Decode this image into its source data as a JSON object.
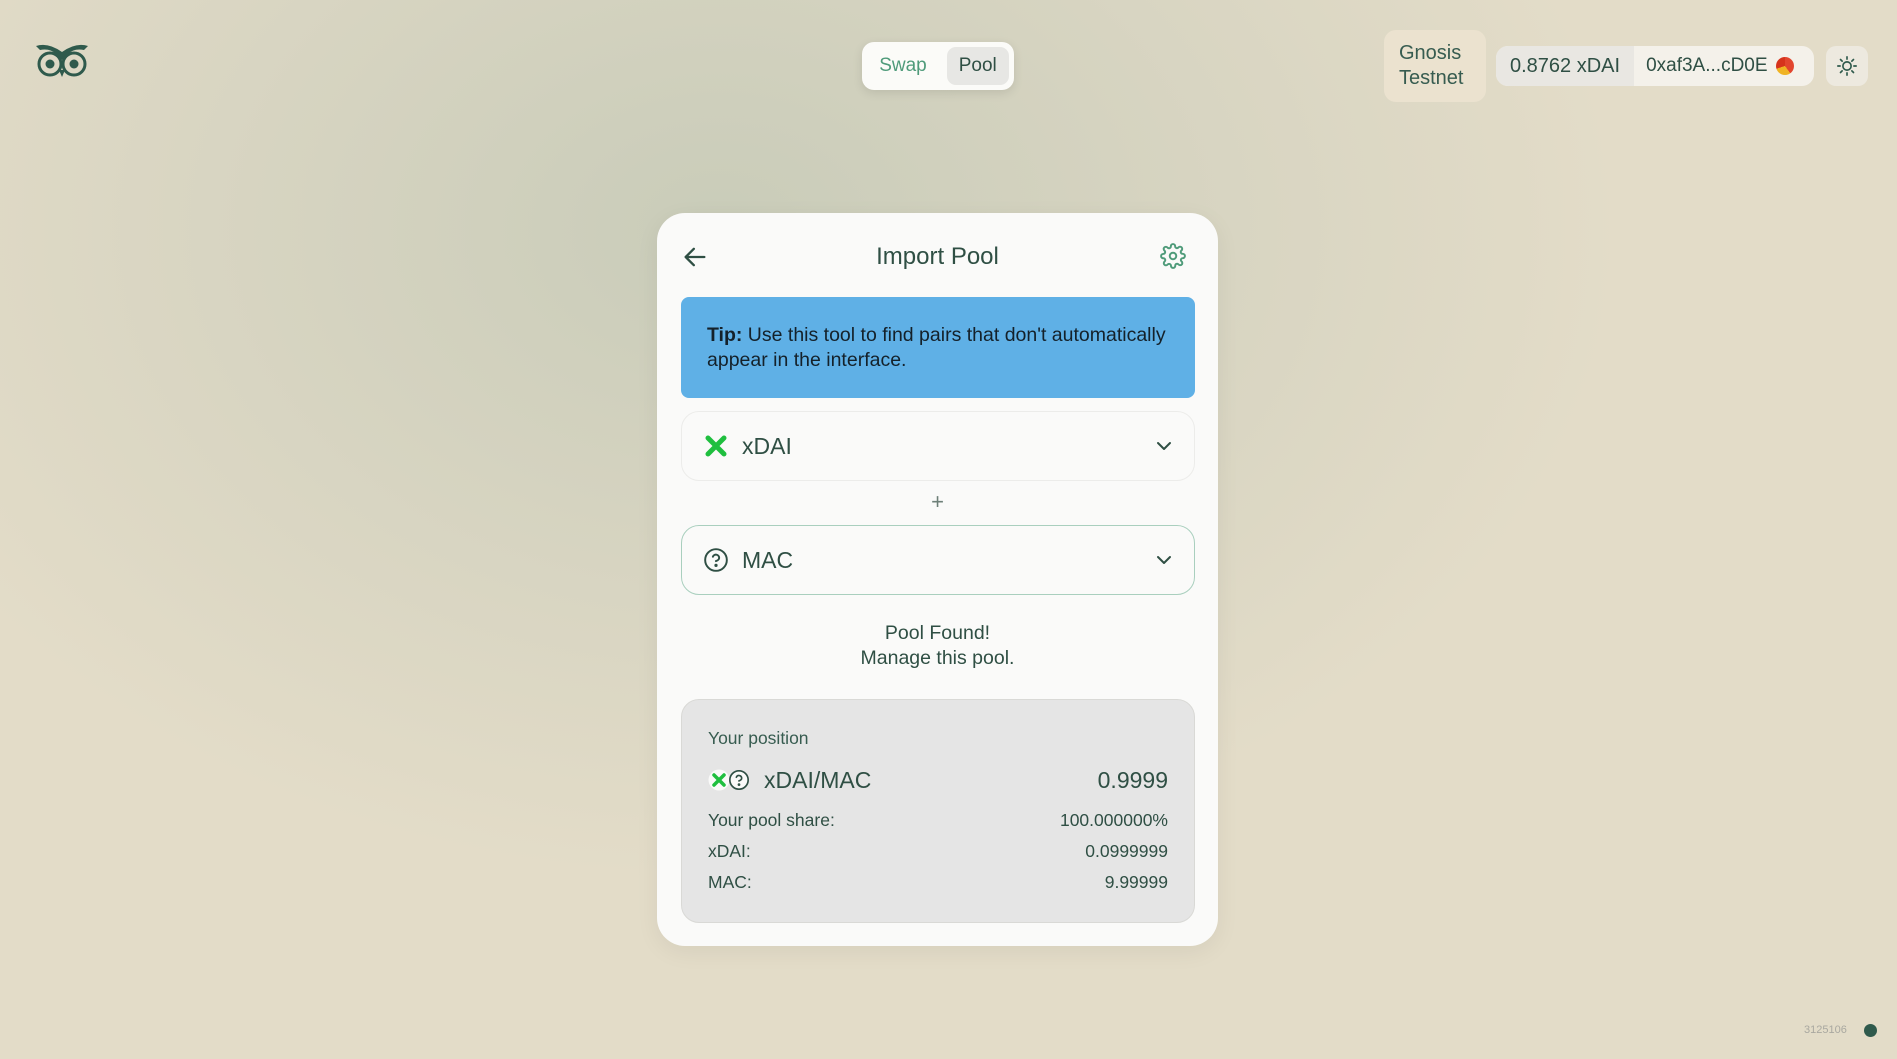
{
  "header": {
    "logo_icon": "owl-logo-icon",
    "nav": {
      "swap_label": "Swap",
      "pool_label": "Pool",
      "active": "Pool"
    },
    "network": {
      "line1": "Gnosis",
      "line2": "Testnet"
    },
    "wallet": {
      "balance": "0.8762 xDAI",
      "address": "0xaf3A...cD0E"
    },
    "theme_icon": "sun-icon"
  },
  "card": {
    "title": "Import Pool",
    "back_icon": "arrow-left-icon",
    "settings_icon": "gear-icon",
    "tip": {
      "label": "Tip:",
      "text": " Use this tool to find pairs that don't automatically appear in the interface."
    },
    "token_a": {
      "symbol": "xDAI",
      "icon": "xdai-token-icon"
    },
    "plus": "+",
    "token_b": {
      "symbol": "MAC",
      "icon": "question-token-icon"
    },
    "status": {
      "line1": "Pool Found!",
      "line2": "Manage this pool."
    },
    "position": {
      "title": "Your position",
      "pair": "xDAI/MAC",
      "pair_value": "0.9999",
      "share_label": "Your pool share:",
      "share_value": "100.000000%",
      "token_a_label": "xDAI:",
      "token_a_value": "0.0999999",
      "token_b_label": "MAC:",
      "token_b_value": "9.99999"
    }
  },
  "footer": {
    "build": "3125106",
    "status_color": "#2f5a4c"
  },
  "colors": {
    "accent": "#4f9b7a",
    "tip_bg": "#5fb0e6",
    "text": "#2f4f44",
    "xdai_green": "#1fbf3f"
  }
}
